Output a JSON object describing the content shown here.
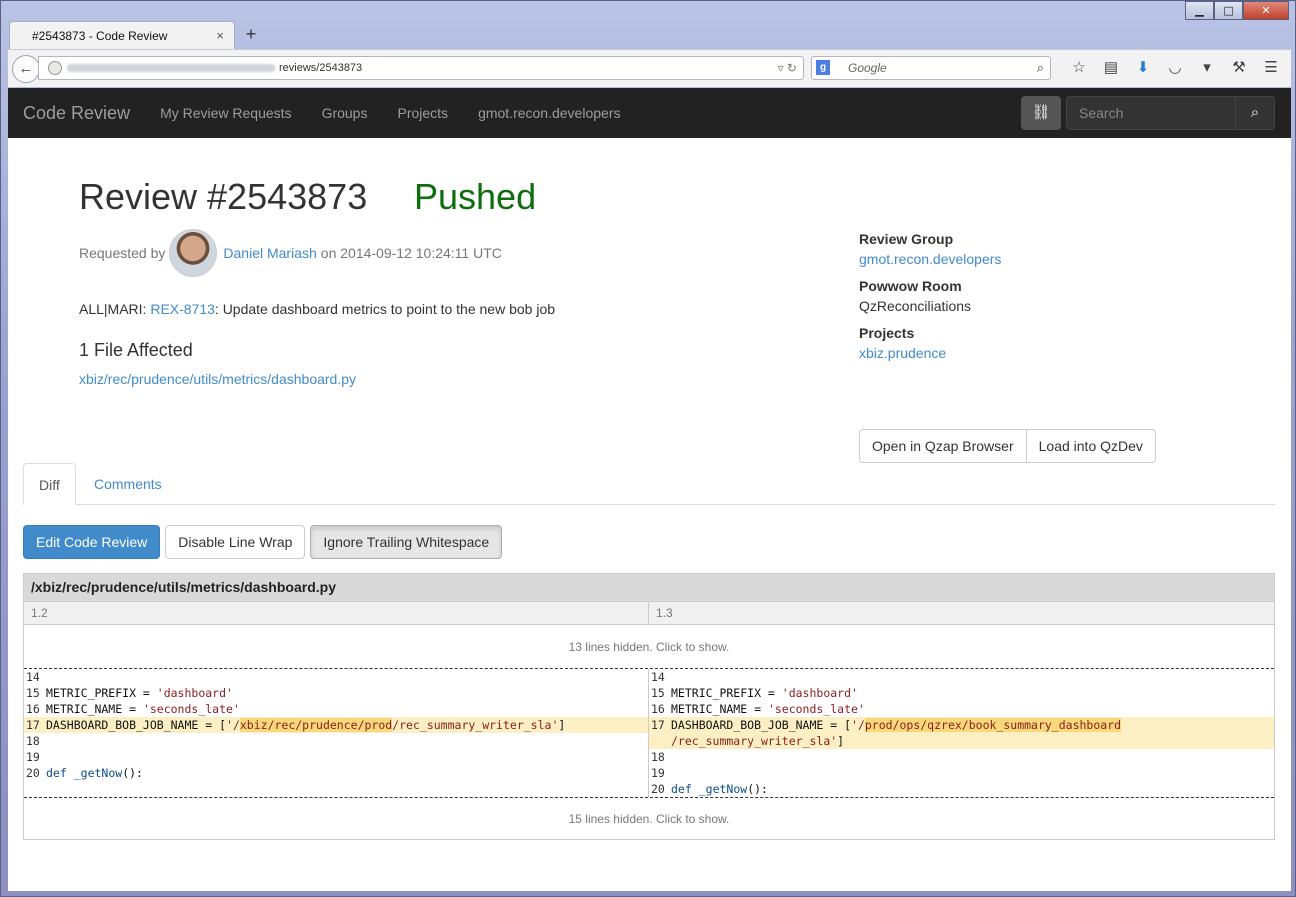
{
  "browser": {
    "tab_title": "#2543873 - Code Review",
    "tab_close": "×",
    "new_tab": "+",
    "url_path": "reviews/2543873",
    "search_placeholder": "Google",
    "win_min": "▁",
    "win_max": "□",
    "win_close": "✕"
  },
  "nav": {
    "brand": "Code Review",
    "links": [
      "My Review Requests",
      "Groups",
      "Projects",
      "gmot.recon.developers"
    ],
    "search_placeholder": "Search"
  },
  "review": {
    "title": "Review #2543873",
    "status": "Pushed",
    "requested_by_label": "Requested by",
    "requester": "Daniel Mariash",
    "requested_on": "on 2014-09-12 10:24:11 UTC",
    "summary_prefix": "ALL|MARI: ",
    "ticket": "REX-8713",
    "summary_text": ": Update dashboard metrics to point to the new bob job",
    "files_affected": "1 File Affected",
    "file_path": "xbiz/rec/prudence/utils/metrics/dashboard.py"
  },
  "sidebar": {
    "review_group_label": "Review Group",
    "review_group": "gmot.recon.developers",
    "powwow_label": "Powwow Room",
    "powwow": "QzReconciliations",
    "projects_label": "Projects",
    "project": "xbiz.prudence",
    "btn_qzap": "Open in Qzap Browser",
    "btn_qzdev": "Load into QzDev"
  },
  "tabs": {
    "diff": "Diff",
    "comments": "Comments"
  },
  "actions": {
    "edit": "Edit Code Review",
    "wrap": "Disable Line Wrap",
    "whitespace": "Ignore Trailing Whitespace"
  },
  "diff": {
    "file_header": "/xbiz/rec/prudence/utils/metrics/dashboard.py",
    "left_rev": "1.2",
    "right_rev": "1.3",
    "hidden_top": "13 lines hidden. Click to show.",
    "hidden_bottom": "15 lines hidden. Click to show."
  },
  "colors": {
    "accent": "#428bca",
    "pushed": "#0e6e0e",
    "change_bg": "#fcefc3",
    "change_hl": "#f7d87a"
  }
}
